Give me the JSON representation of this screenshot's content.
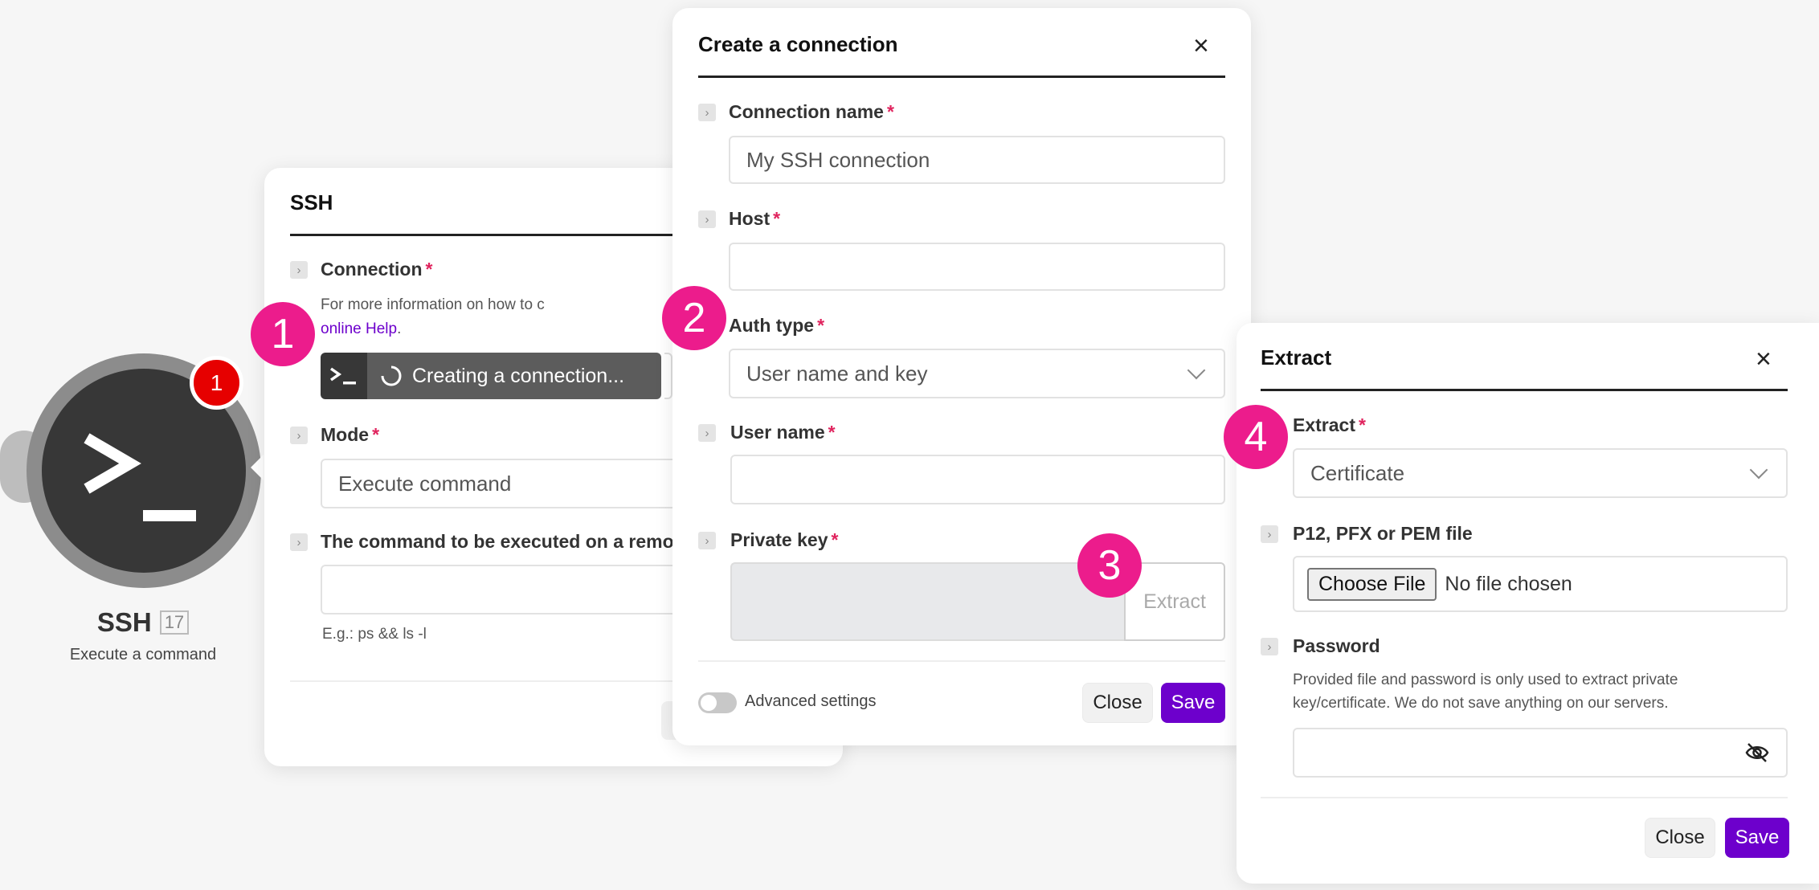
{
  "module": {
    "title": "SSH",
    "id_label": "17",
    "subtitle": "Execute a command",
    "badge_count": "1"
  },
  "ssh_panel": {
    "title": "SSH",
    "connection_label": "Connection",
    "connection_help": "For more information on how to create a connec",
    "online_help_link": "online Help",
    "connection_status": "Creating a connection...",
    "mode_label": "Mode",
    "mode_value": "Execute command",
    "command_label": "The command to be executed on a remot",
    "command_hint": "E.g.: ps && ls -l"
  },
  "create_connection": {
    "title": "Create a connection",
    "connection_name_label": "Connection name",
    "connection_name_value": "My SSH connection",
    "host_label": "Host",
    "auth_type_label": "Auth type",
    "auth_type_value": "User name and key",
    "user_name_label": "User name",
    "private_key_label": "Private key",
    "extract_button": "Extract",
    "advanced_settings_label": "Advanced settings",
    "close_button": "Close",
    "save_button": "Save"
  },
  "extract_panel": {
    "title": "Extract",
    "extract_label": "Extract",
    "extract_value": "Certificate",
    "file_label": "P12, PFX or PEM file",
    "choose_file_button": "Choose File",
    "no_file_text": "No file chosen",
    "password_label": "Password",
    "password_help": "Provided file and password is only used to extract private key/certificate. We do not save anything on our servers.",
    "close_button": "Close",
    "save_button": "Save"
  },
  "markers": [
    "1",
    "2",
    "3",
    "4"
  ],
  "colors": {
    "accent": "#6d00cc",
    "marker": "#ec1c8c",
    "required": "#e0245e",
    "link": "#6d00cc",
    "node_dark": "#373737",
    "badge": "#e60000"
  }
}
